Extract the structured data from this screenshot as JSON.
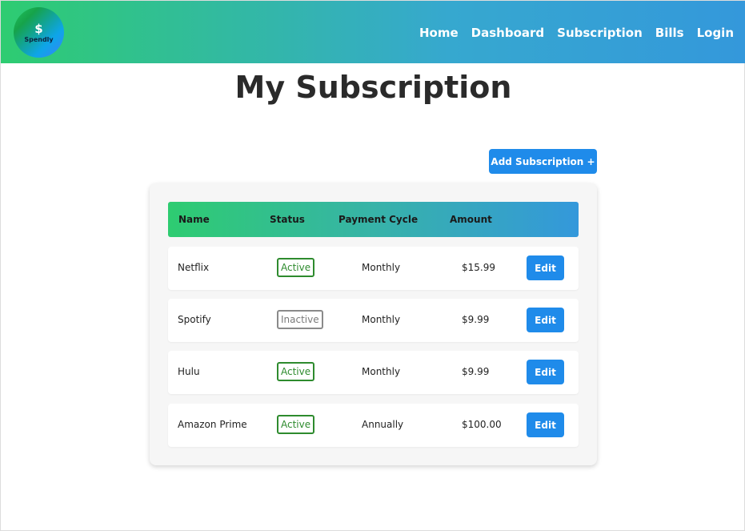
{
  "brand": {
    "name": "Spendly",
    "symbol": "$"
  },
  "nav": {
    "items": [
      "Home",
      "Dashboard",
      "Subscription",
      "Bills",
      "Login"
    ]
  },
  "page": {
    "title": "My Subscription",
    "add_button_label": "Add Subscription +"
  },
  "table": {
    "headers": [
      "Name",
      "Status",
      "Payment Cycle",
      "Amount"
    ],
    "rows": [
      {
        "name": "Netflix",
        "status": "Active",
        "cycle": "Monthly",
        "amount": "$15.99",
        "action": "Edit"
      },
      {
        "name": "Spotify",
        "status": "Inactive",
        "cycle": "Monthly",
        "amount": "$9.99",
        "action": "Edit"
      },
      {
        "name": "Hulu",
        "status": "Active",
        "cycle": "Monthly",
        "amount": "$9.99",
        "action": "Edit"
      },
      {
        "name": "Amazon Prime",
        "status": "Active",
        "cycle": "Annually",
        "amount": "$100.00",
        "action": "Edit"
      }
    ]
  },
  "colors": {
    "accent": "#1f8bea",
    "gradient_start": "#2ecc71",
    "gradient_end": "#3498db",
    "active": "#2e8b2e",
    "inactive": "#7a7a7a"
  }
}
